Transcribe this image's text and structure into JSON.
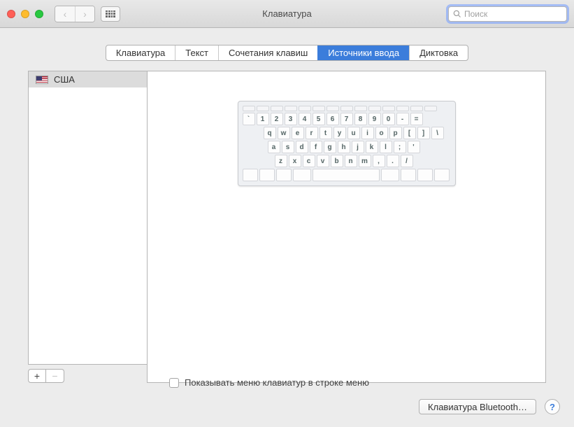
{
  "window": {
    "title": "Клавиатура"
  },
  "search": {
    "placeholder": "Поиск",
    "value": ""
  },
  "tabs": [
    {
      "id": "keyboard",
      "label": "Клавиатура",
      "active": false
    },
    {
      "id": "text",
      "label": "Текст",
      "active": false
    },
    {
      "id": "shortcuts",
      "label": "Сочетания клавиш",
      "active": false
    },
    {
      "id": "input",
      "label": "Источники ввода",
      "active": true
    },
    {
      "id": "dictation",
      "label": "Диктовка",
      "active": false
    }
  ],
  "sources": [
    {
      "name": "США",
      "flag": "us",
      "selected": true
    }
  ],
  "addremove": {
    "add": "+",
    "remove": "−"
  },
  "showMenu": {
    "checked": false,
    "label": "Показывать меню клавиатур в строке меню"
  },
  "bluetoothButton": "Клавиатура Bluetooth…",
  "helpButton": "?",
  "keyboard": {
    "row1": [
      "`",
      "1",
      "2",
      "3",
      "4",
      "5",
      "6",
      "7",
      "8",
      "9",
      "0",
      "-",
      "="
    ],
    "row2": [
      "q",
      "w",
      "e",
      "r",
      "t",
      "y",
      "u",
      "i",
      "o",
      "p",
      "[",
      "]",
      "\\"
    ],
    "row3": [
      "a",
      "s",
      "d",
      "f",
      "g",
      "h",
      "j",
      "k",
      "l",
      ";",
      "'"
    ],
    "row4": [
      "z",
      "x",
      "c",
      "v",
      "b",
      "n",
      "m",
      ",",
      ".",
      "/"
    ]
  }
}
